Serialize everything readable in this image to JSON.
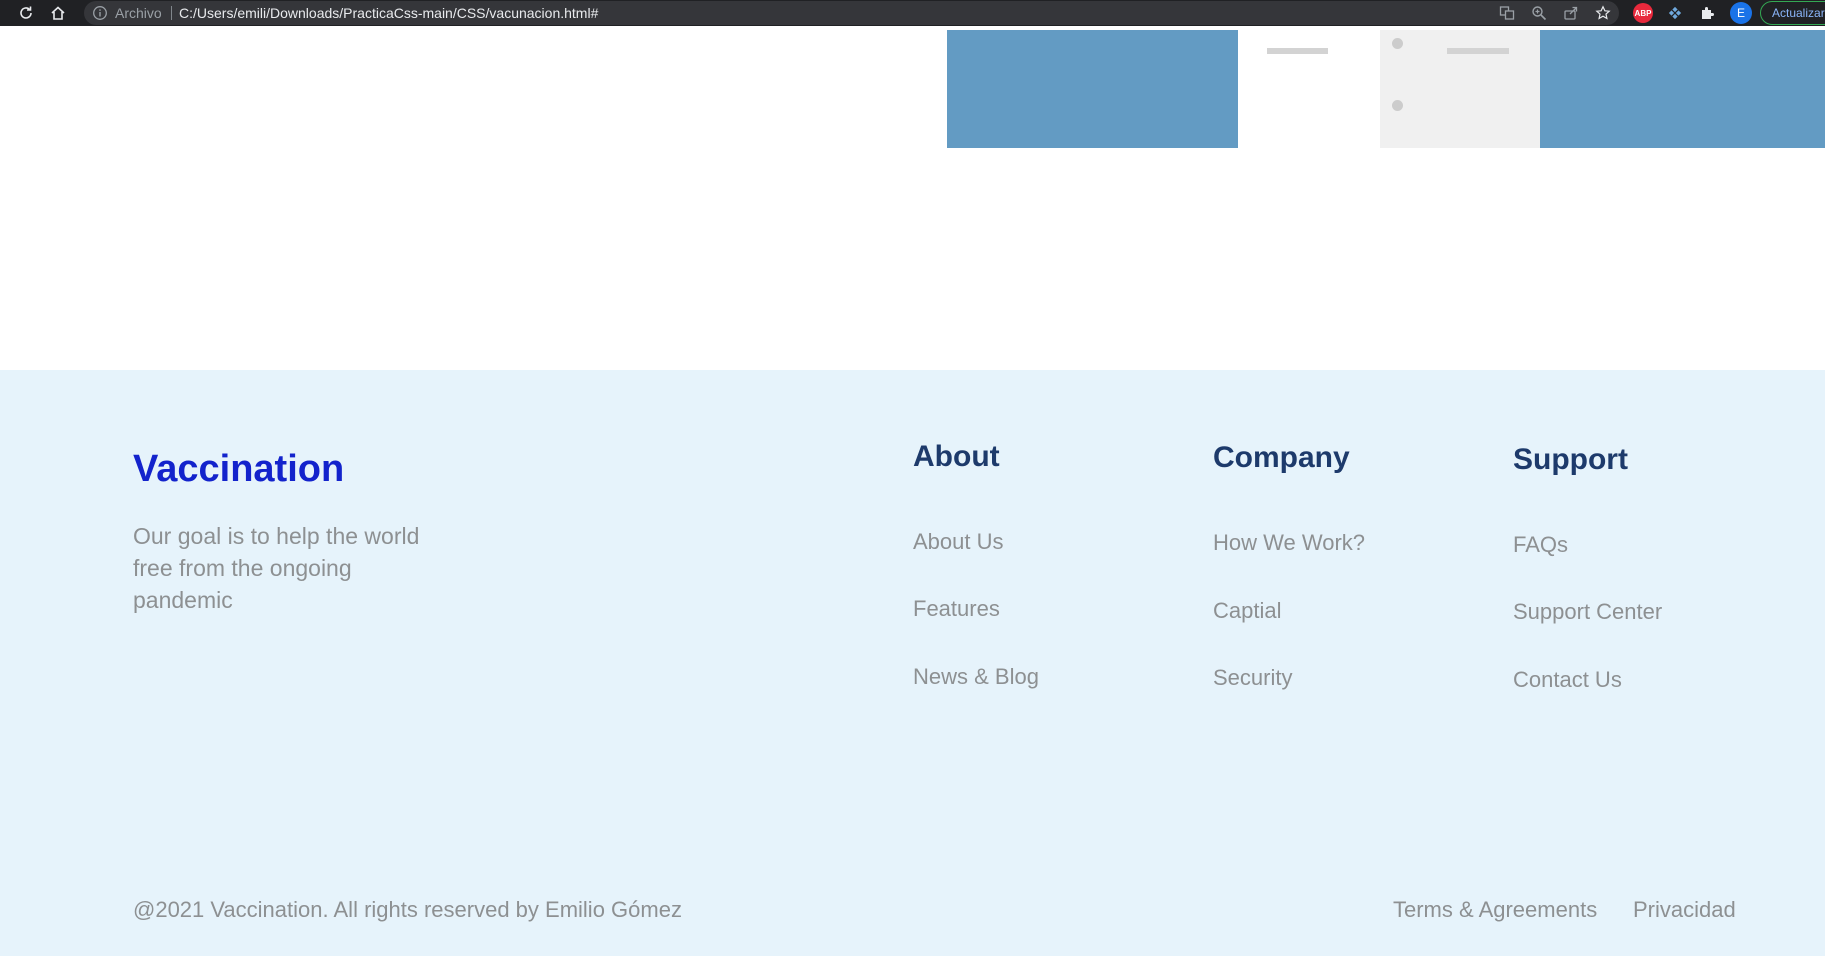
{
  "browser": {
    "scheme_label": "Archivo",
    "url": "C:/Users/emili/Downloads/PracticaCss-main/CSS/vacunacion.html#",
    "extensions": {
      "abp_label": "ABP"
    },
    "profile_initial": "E",
    "update_label": "Actualizar"
  },
  "footer": {
    "brand": "Vaccination",
    "tagline": "Our goal is to help the world free from the ongoing pandemic",
    "columns": [
      {
        "title": "About",
        "links": [
          "About Us",
          "Features",
          "News & Blog"
        ]
      },
      {
        "title": "Company",
        "links": [
          "How We Work?",
          "Captial",
          "Security"
        ]
      },
      {
        "title": "Support",
        "links": [
          "FAQs",
          "Support Center",
          "Contact Us"
        ]
      }
    ],
    "copyright": "@2021 Vaccination. All rights reserved by Emilio Gómez",
    "legal_links": [
      "Terms & Agreements",
      "Privacidad"
    ]
  },
  "colors": {
    "chrome_bg": "#202124",
    "footer_bg": "#e6f3fb",
    "brand_blue": "#1323cc",
    "heading_navy": "#1d3a6b",
    "muted_text": "#8d9092",
    "illustration_blue": "#639bc3"
  }
}
